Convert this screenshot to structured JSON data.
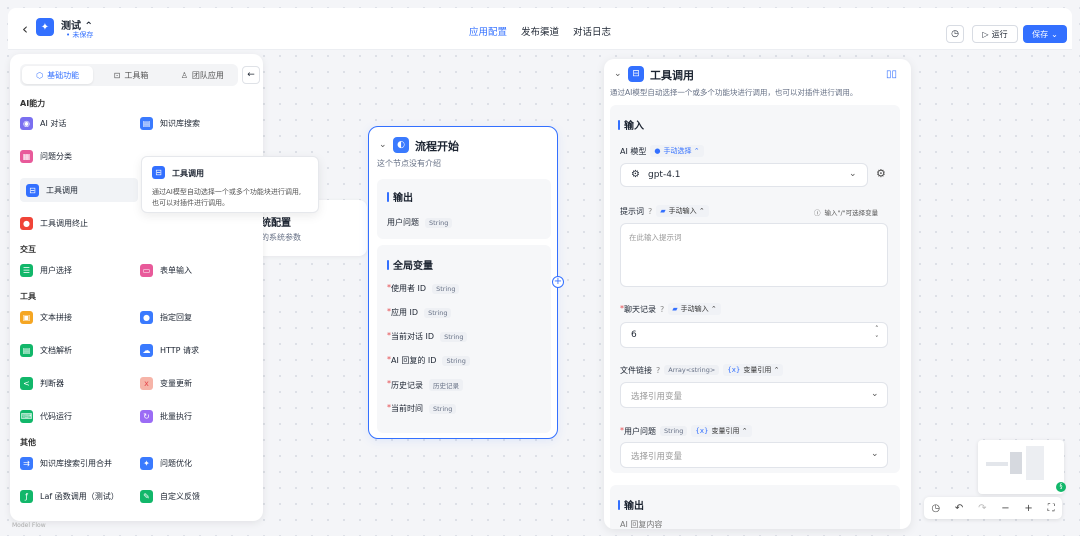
{
  "header": {
    "back_icon": "chevron-left-icon",
    "app_name": "测试 ⌃",
    "app_status": "• 未保存",
    "tabs": [
      {
        "label": "应用配置",
        "active": true
      },
      {
        "label": "发布渠道",
        "active": false
      },
      {
        "label": "对话日志",
        "active": false
      }
    ],
    "history_icon": "clock-icon",
    "run_label": "运行",
    "save_label": "保存",
    "accent": "#3370ff"
  },
  "panel": {
    "tabs": [
      {
        "label": "基础功能",
        "icon": "cube-icon",
        "active": true
      },
      {
        "label": "工具箱",
        "icon": "toolbox-icon",
        "active": false
      },
      {
        "label": "团队应用",
        "icon": "user-icon",
        "active": false
      }
    ],
    "collapse_icon": "arrow-left-icon",
    "categories": {
      "ai": "AI能力",
      "interact": "交互",
      "tools": "工具",
      "other": "其他"
    },
    "modules": {
      "ai_chat": "AI 对话",
      "kb_search": "知识库搜索",
      "q_classify": "问题分类",
      "tool_call": "工具调用",
      "tool_end": "工具调用终止",
      "user_select": "用户选择",
      "form_input": "表单输入",
      "text_concat": "文本拼接",
      "specified_reply": "指定回复",
      "doc_parse": "文档解析",
      "http": "HTTP 请求",
      "judge": "判断器",
      "var_update": "变量更新",
      "code_run": "代码运行",
      "batch_run": "批量执行",
      "kb_merge": "知识库搜索引用合并",
      "q_optimize": "问题优化",
      "laf": "Laf 函数调用（测试）",
      "custom_feedback": "自定义反馈"
    },
    "footer": "Model Flow"
  },
  "tooltip": {
    "title": "工具调用",
    "desc_line1": "通过AI模型自动选择一个或多个功能块进行调用,",
    "desc_line2": "也可以对插件进行调用。"
  },
  "sys_node": {
    "title": "统配置",
    "desc": "的系统参数"
  },
  "start_node": {
    "title": "流程开始",
    "desc": "这个节点没有介绍",
    "output_title": "输出",
    "output_field": "用户问题",
    "output_type": "String",
    "globals_title": "全局变量",
    "globals": [
      {
        "name": "使用者 ID",
        "type": "String"
      },
      {
        "name": "应用 ID",
        "type": "String"
      },
      {
        "name": "当前对话 ID",
        "type": "String"
      },
      {
        "name": "AI 回复的 ID",
        "type": "String"
      },
      {
        "name": "历史记录",
        "type": "历史记录"
      },
      {
        "name": "当前时间",
        "type": "String"
      }
    ]
  },
  "tool_node": {
    "title": "工具调用",
    "desc": "通过AI模型自动选择一个或多个功能块进行调用，也可以对插件进行调用。",
    "input_title": "输入",
    "ai_model_label": "AI 模型",
    "ai_model_mode": "手动选择 ⌃",
    "model_value": "gpt-4.1",
    "prompt_label": "提示词",
    "prompt_mode": "手动输入 ⌃",
    "prompt_hint": "输入\"/\"可选择变量",
    "prompt_placeholder": "在此输入提示词",
    "history_label": "聊天记录",
    "history_mode": "手动输入 ⌃",
    "history_value": "6",
    "file_label": "文件链接",
    "file_type": "Array<string>",
    "file_mode": "变量引用 ⌃",
    "file_placeholder": "选择引用变量",
    "question_label": "用户问题",
    "question_type": "String",
    "question_mode": "变量引用 ⌃",
    "question_placeholder": "选择引用变量",
    "output_title": "输出",
    "output_field_cut": "AI 回复内容"
  }
}
